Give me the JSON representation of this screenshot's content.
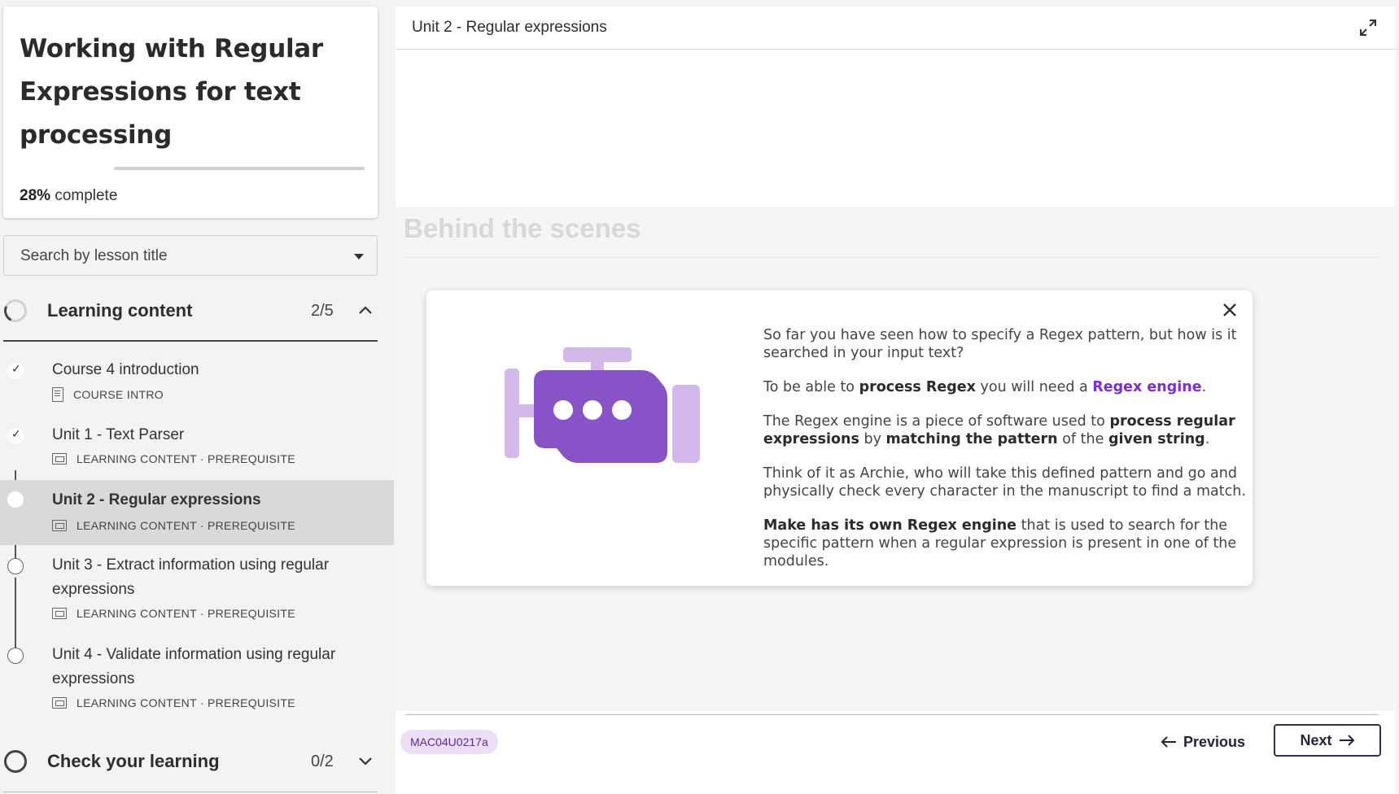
{
  "course": {
    "title": "Working with Regular Expressions for text processing",
    "progress_percent": "28%",
    "progress_label": "complete",
    "progress_value": 0.0
  },
  "search": {
    "placeholder": "Search by lesson title"
  },
  "sections": [
    {
      "title": "Learning content",
      "count": "2/5",
      "expanded": true
    },
    {
      "title": "Check your learning",
      "count": "0/2",
      "expanded": false
    }
  ],
  "lessons": [
    {
      "name": "Course 4 introduction",
      "meta": "COURSE INTRO",
      "status": "done"
    },
    {
      "name": "Unit 1 - Text Parser",
      "meta": "LEARNING CONTENT · PREREQUISITE",
      "status": "done"
    },
    {
      "name": "Unit 2 - Regular expressions",
      "meta": "LEARNING CONTENT · PREREQUISITE",
      "status": "current"
    },
    {
      "name": "Unit 3 - Extract information using regular expressions",
      "meta": "LEARNING CONTENT · PREREQUISITE",
      "status": "todo"
    },
    {
      "name": "Unit 4 - Validate information using regular expressions",
      "meta": "LEARNING CONTENT · PREREQUISITE",
      "status": "todo"
    }
  ],
  "main": {
    "header_title": "Unit 2 - Regular expressions",
    "faded_heading": "Behind the scenes"
  },
  "modal": {
    "p1": "So far you have seen how to specify a Regex pattern, but how is it searched in your input text?",
    "p2": {
      "t1": "To be able to ",
      "b1": "process Regex",
      "t2": " you will need a ",
      "link": "Regex engine",
      "t3": "."
    },
    "p3": {
      "t1": "The Regex engine is a piece of software used to ",
      "b1": "process regular expressions",
      "t2": " by ",
      "b2": "matching the pattern",
      "t3": " of the ",
      "b3": "given string",
      "t4": "."
    },
    "p4": "Think of it as Archie, who will take this defined pattern and go and physically check every character in the manuscript to find a match.",
    "p5": {
      "b1": "Make has its own Regex engine",
      "t1": " that is used to search for the specific pattern when a regular expression is present in one of the modules."
    }
  },
  "footer": {
    "code": "MAC04U0217a",
    "previous": "Previous",
    "next": "Next"
  },
  "colors": {
    "accent": "#7a2fd0",
    "robot_dark": "#8753c6",
    "robot_light": "#d2b9ea",
    "active_row": "#d9d9d9"
  }
}
